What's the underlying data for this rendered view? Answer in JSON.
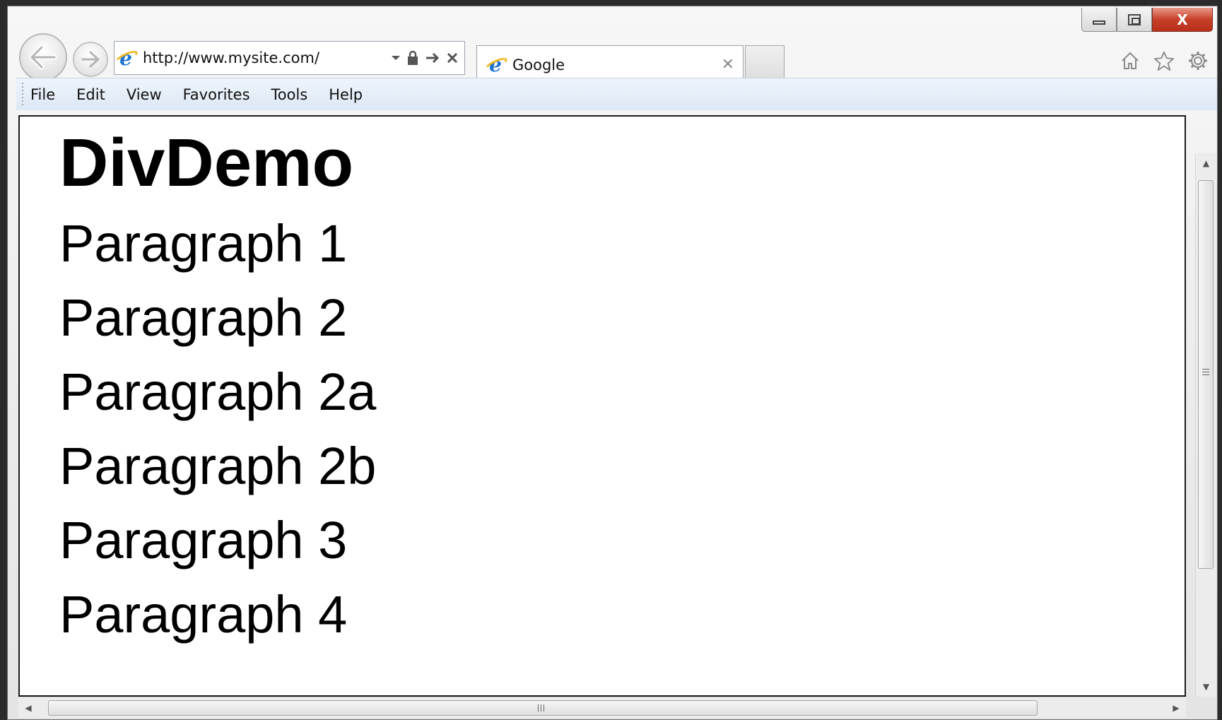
{
  "browser": {
    "address": {
      "url": "http://www.mysite.com/",
      "icon": "ie-icon"
    },
    "tab": {
      "title": "Google",
      "close_glyph": "✕"
    },
    "window_controls": {
      "close_glyph": "X"
    },
    "icons": [
      "back-arrow-icon",
      "forward-arrow-icon",
      "dropdown-icon",
      "lock-icon",
      "go-arrow-icon",
      "stop-icon",
      "home-icon",
      "star-icon",
      "gear-icon"
    ]
  },
  "menubar": {
    "items": [
      "File",
      "Edit",
      "View",
      "Favorites",
      "Tools",
      "Help"
    ]
  },
  "page": {
    "heading": "DivDemo",
    "paragraphs": [
      "Paragraph 1",
      "Paragraph 2",
      "Paragraph 2a",
      "Paragraph 2b",
      "Paragraph 3",
      "Paragraph 4"
    ]
  },
  "colors": {
    "close_button": "#c7402a",
    "menubar_bg": "#e6eef8",
    "ie_blue": "#1f74d0",
    "ie_ring": "#f2b824"
  }
}
